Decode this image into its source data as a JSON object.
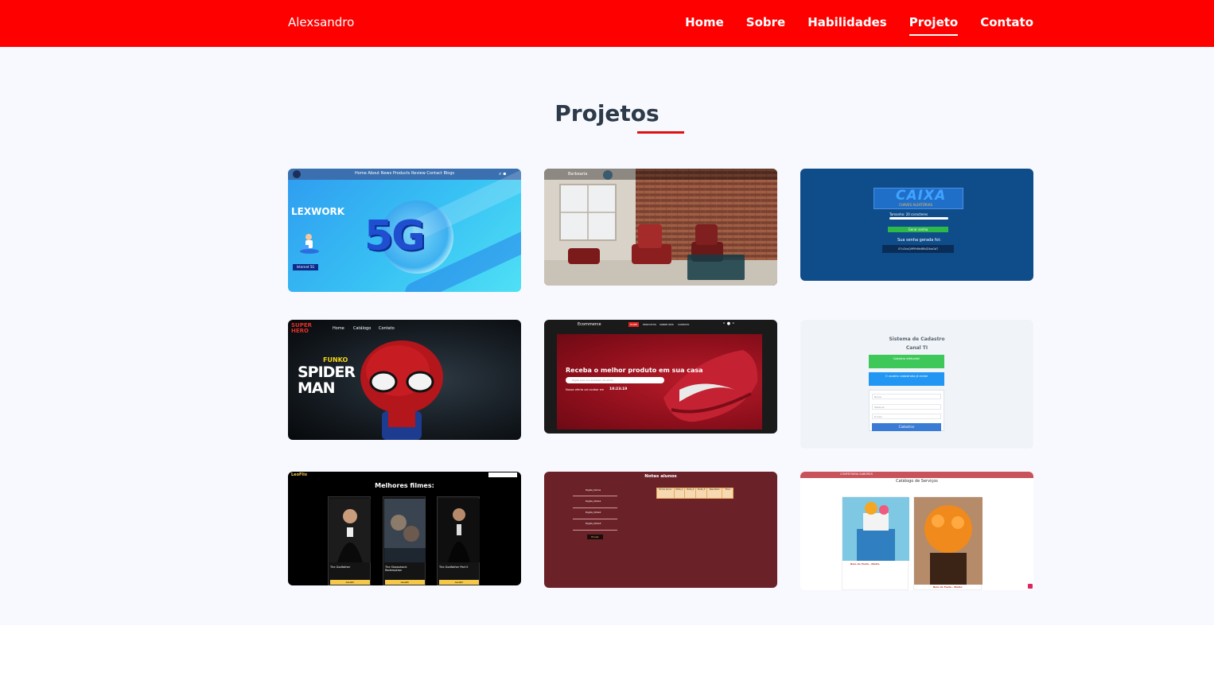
{
  "header": {
    "brand": "Alexsandro",
    "nav": [
      "Home",
      "Sobre",
      "Habilidades",
      "Projeto",
      "Contato"
    ],
    "active": "Projeto"
  },
  "section": {
    "title": "Projetos"
  },
  "projects": {
    "lexwork": {
      "brand": "LEXWORK",
      "hero": "5G",
      "nav": "Home  About  News  Products  Review  Contact  Blogs",
      "cta": "Internet 5G"
    },
    "barbearia": {
      "brand": "Barbearia"
    },
    "caixa": {
      "logo": "CAIXA",
      "subtitle": "CHAVES ALEATÓRIAS",
      "label": "Tamanho: 20 caracteres",
      "button": "Gerar senha",
      "result_label": "Sua senha gerada foi:",
      "result": "X7n2kxQ9PfhMe8RdZ4wGbT"
    },
    "funko": {
      "logo": "SUPER HERO",
      "nav": [
        "Home",
        "Catálogo",
        "Contato"
      ],
      "title_top": "FUNKO",
      "title": "SPIDER MAN"
    },
    "ecommerce": {
      "brand": "Ecommerce",
      "nav": [
        "HOME",
        "PRODUTOS",
        "SOBRE NÓS",
        "CONTATO"
      ],
      "headline": "Receba o melhor produto em sua casa",
      "search": "Digite aqui seu endereço de email",
      "offer": "Nossa oferta vai acabar em",
      "timer": "10:23:19"
    },
    "cadastro": {
      "title": "Sistema de Cadastro",
      "subtitle": "Canal TI",
      "success": "Cadastro efetuado!",
      "info": "O usuário cadastrado já existe",
      "fields": [
        "Nome",
        "Telefone",
        "E-mail"
      ],
      "button": "Cadastrar"
    },
    "leoflix": {
      "brand": "LeoFlix",
      "heading": "Melhores filmes:",
      "movies": [
        "The Godfather",
        "The Shawshank Redemption",
        "The Godfather Part II"
      ],
      "button": "Assistir"
    },
    "notas": {
      "title": "Notas alunos",
      "labels": [
        "Digite_Nome",
        "Digite_Nota1",
        "Digite_Nota2",
        "Digite_Nota3"
      ],
      "button": "Enviar",
      "headers": [
        "Nome Aluno",
        "Nota_1",
        "Nota_2",
        "Nota_3",
        "Resultado",
        "Final"
      ]
    },
    "confeitaria": {
      "brand": "CONFEITARIA SABORES",
      "title": "Catálogo de Serviços",
      "item": "Bolo de Festa - Médio"
    }
  }
}
